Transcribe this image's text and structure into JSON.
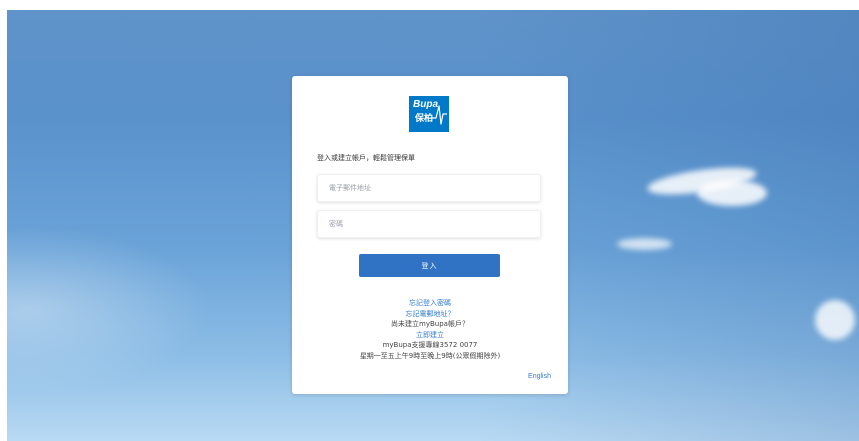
{
  "brand": {
    "logo_en": "Bupa",
    "logo_zh": "保柏",
    "color": "#0079c8"
  },
  "login": {
    "intro": "登入或建立帳戶，輕鬆管理保單",
    "email_placeholder": "電子郵件地址",
    "password_placeholder": "密碼",
    "submit_label": "登入",
    "forgot_password": "忘記登入密碼",
    "forgot_email": "忘記電郵地址？",
    "no_account": "尚未建立myBupa帳戶？",
    "create_now": "立即建立",
    "support_line": "myBupa支援專線3572 0077",
    "support_hours": "星期一至五上午9時至晚上9時(公眾假期除外)",
    "language_toggle": "English"
  },
  "colors": {
    "button": "#3072c4",
    "link": "#2f7bd0"
  }
}
